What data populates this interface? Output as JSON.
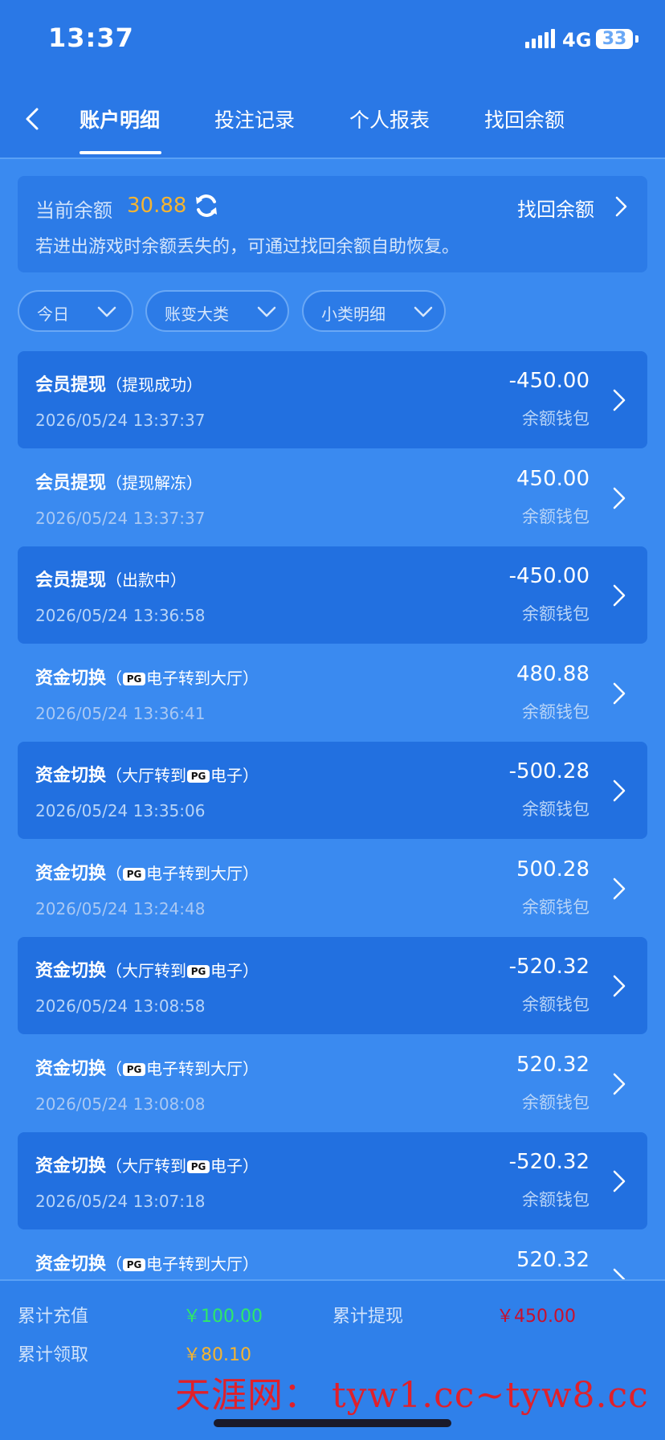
{
  "status_bar": {
    "time": "13:37",
    "network": "4G",
    "battery": "33"
  },
  "nav": {
    "tabs": [
      {
        "label": "账户明细",
        "active": true
      },
      {
        "label": "投注记录",
        "active": false
      },
      {
        "label": "个人报表",
        "active": false
      },
      {
        "label": "找回余额",
        "active": false
      }
    ]
  },
  "balance": {
    "label": "当前余额",
    "amount": "30.88",
    "recover_label": "找回余额",
    "note": "若进出游戏时余额丢失的，可通过找回余额自助恢复。"
  },
  "filters": [
    "今日",
    "账变大类",
    "小类明细"
  ],
  "transactions": [
    {
      "title": "会员提现",
      "sub_prefix": "（提现成功）",
      "pg": "",
      "sub_suffix": "",
      "time": "2026/05/24 13:37:37",
      "amount": "-450.00",
      "wallet": "余额钱包"
    },
    {
      "title": "会员提现",
      "sub_prefix": "（提现解冻）",
      "pg": "",
      "sub_suffix": "",
      "time": "2026/05/24 13:37:37",
      "amount": "450.00",
      "wallet": "余额钱包"
    },
    {
      "title": "会员提现",
      "sub_prefix": "（出款中）",
      "pg": "",
      "sub_suffix": "",
      "time": "2026/05/24 13:36:58",
      "amount": "-450.00",
      "wallet": "余额钱包"
    },
    {
      "title": "资金切换",
      "sub_prefix": "（",
      "pg": "PG",
      "sub_suffix": "电子转到大厅）",
      "time": "2026/05/24 13:36:41",
      "amount": "480.88",
      "wallet": "余额钱包"
    },
    {
      "title": "资金切换",
      "sub_prefix": "（大厅转到",
      "pg": "PG",
      "sub_suffix": "电子）",
      "time": "2026/05/24 13:35:06",
      "amount": "-500.28",
      "wallet": "余额钱包"
    },
    {
      "title": "资金切换",
      "sub_prefix": "（",
      "pg": "PG",
      "sub_suffix": "电子转到大厅）",
      "time": "2026/05/24 13:24:48",
      "amount": "500.28",
      "wallet": "余额钱包"
    },
    {
      "title": "资金切换",
      "sub_prefix": "（大厅转到",
      "pg": "PG",
      "sub_suffix": "电子）",
      "time": "2026/05/24 13:08:58",
      "amount": "-520.32",
      "wallet": "余额钱包"
    },
    {
      "title": "资金切换",
      "sub_prefix": "（",
      "pg": "PG",
      "sub_suffix": "电子转到大厅）",
      "time": "2026/05/24 13:08:08",
      "amount": "520.32",
      "wallet": "余额钱包"
    },
    {
      "title": "资金切换",
      "sub_prefix": "（大厅转到",
      "pg": "PG",
      "sub_suffix": "电子）",
      "time": "2026/05/24 13:07:18",
      "amount": "-520.32",
      "wallet": "余额钱包"
    },
    {
      "title": "资金切换",
      "sub_prefix": "（",
      "pg": "PG",
      "sub_suffix": "电子转到大厅）",
      "time": "",
      "amount": "520.32",
      "wallet": ""
    }
  ],
  "summary": {
    "recharge_label": "累计充值",
    "recharge_value": "￥100.00",
    "withdraw_label": "累计提现",
    "withdraw_value": "￥450.00",
    "claim_label": "累计领取",
    "claim_value": "￥80.10"
  },
  "watermark": "天涯网： tyw1.cc~tyw8.cc",
  "colors": {
    "accent_orange": "#f4b432",
    "green": "#2ee86a",
    "red": "#c8102e",
    "background": "#3a8af0"
  }
}
